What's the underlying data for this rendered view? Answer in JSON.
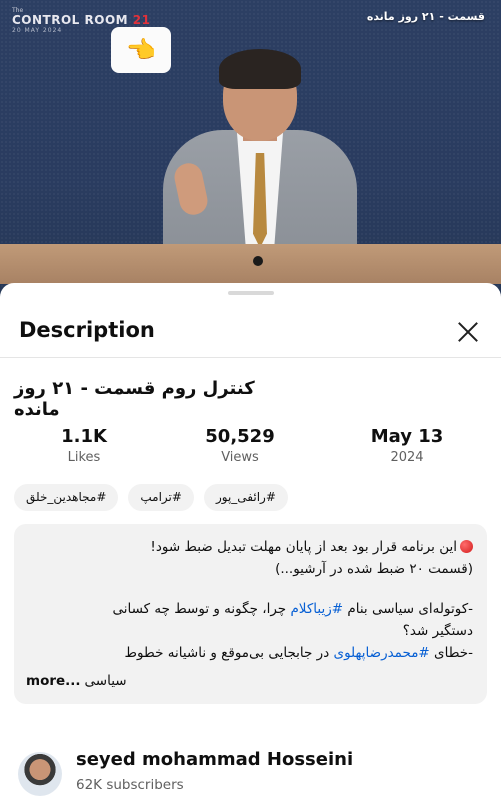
{
  "video": {
    "logo_the": "The",
    "logo_brand": "CONTROL ROOM",
    "logo_number": "21",
    "logo_date": "20 MAY 2024",
    "overlay_title": "قسمت - ۲۱ روز مانده",
    "badge_emoji": "👈"
  },
  "sheet": {
    "title": "Description",
    "close_icon": "close-icon",
    "video_title": "کنترل روم قسمت - ۲۱ روز مانده"
  },
  "stats": {
    "likes_value": "1.1K",
    "likes_label": "Likes",
    "views_value": "50,529",
    "views_label": "Views",
    "date_value": "May 13",
    "date_year": "2024"
  },
  "tags": [
    "#مجاهدین_خلق",
    "#ترامپ",
    "#رائفی_پور"
  ],
  "description": {
    "line1": "این برنامه قرار بود بعد از پایان مهلت تبدیل ضبط شود!",
    "line2": "(قسمت ۲۰ ضبط شده در آرشیو...)",
    "line3_pre": "-کوتوله‌ای سیاسی بنام ",
    "line3_link": "#زیباکلام",
    "line3_post": " چرا، چگونه و توسط چه کسانی",
    "line4": "دستگیر شد؟",
    "line5_pre": "-خطای ",
    "line5_link": "#محمدرضاپهلوی",
    "line5_post": " در جابجایی بی‌موقع و ناشیانه خطوط",
    "line6": "سیاسی",
    "more_label": "...more"
  },
  "channel": {
    "name": "seyed mohammad Hosseini",
    "subscribers": "62K subscribers"
  }
}
